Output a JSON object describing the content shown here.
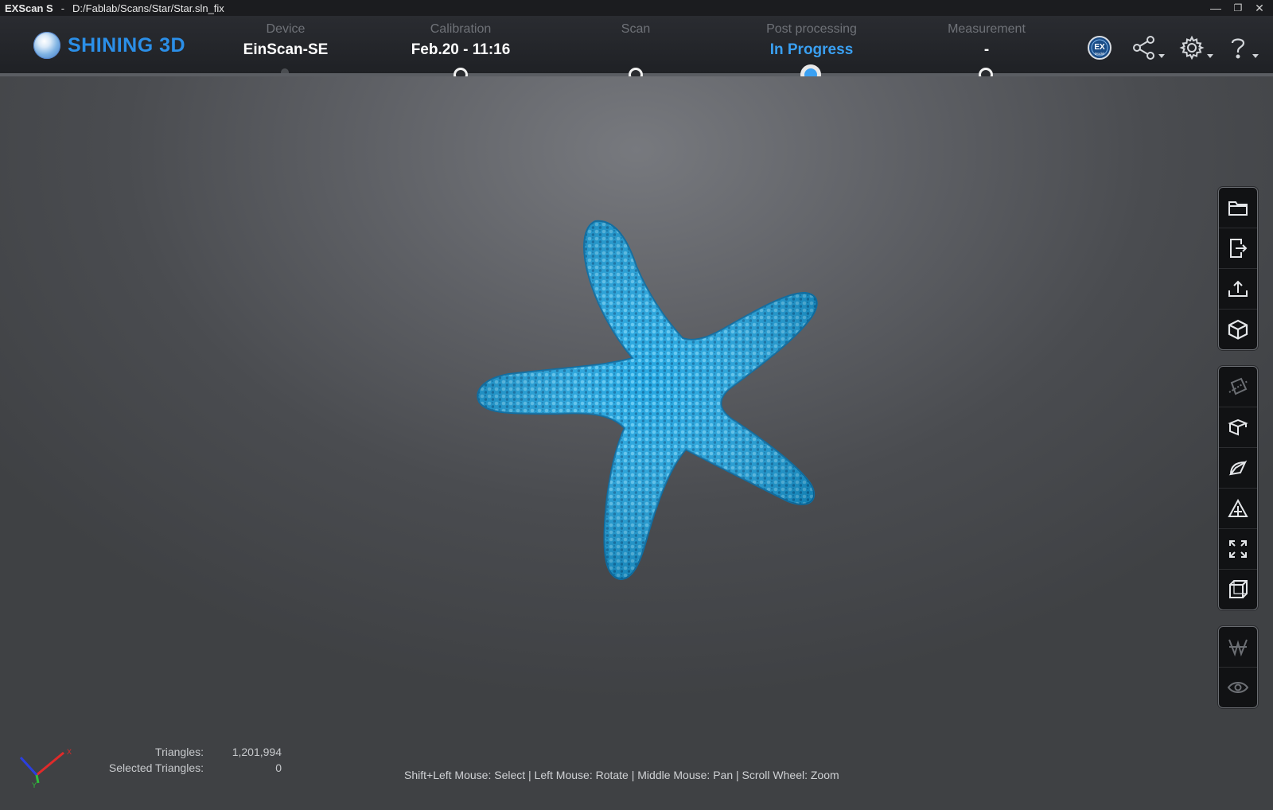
{
  "titlebar": {
    "app_name": "EXScan S",
    "separator": "-",
    "file_path": "D:/Fablab/Scans/Star/Star.sln_fix",
    "minimize_glyph": "—",
    "restore_glyph": "❐",
    "close_glyph": "✕"
  },
  "header": {
    "logo_text": "SHINING 3D",
    "steps": [
      {
        "label": "Device",
        "value": "EinScan-SE",
        "state": "done"
      },
      {
        "label": "Calibration",
        "value": "Feb.20 - 11:16",
        "state": "pending"
      },
      {
        "label": "Scan",
        "value": "",
        "state": "pending"
      },
      {
        "label": "Post processing",
        "value": "In Progress",
        "state": "active"
      },
      {
        "label": "Measurement",
        "value": "-",
        "state": "pending"
      }
    ],
    "icons": [
      "exmodel-icon",
      "share-icon",
      "settings-icon",
      "help-icon"
    ],
    "exmodel_badge": "EX",
    "exmodel_caption": "Model"
  },
  "toolbar": {
    "groups": [
      [
        "open-folder-icon",
        "export-icon",
        "upload-icon",
        "cube-icon"
      ],
      [
        "plane-cut-icon",
        "box-icon",
        "curve-icon",
        "triangle-icon",
        "fit-view-icon",
        "wireframe-box-icon"
      ],
      [
        "mesh-icon",
        "eye-icon"
      ]
    ]
  },
  "stats": {
    "triangles_label": "Triangles:",
    "triangles_value": "1,201,994",
    "selected_label": "Selected Triangles:",
    "selected_value": "0"
  },
  "hint": "Shift+Left Mouse: Select | Left Mouse: Rotate | Middle Mouse: Pan | Scroll Wheel: Zoom",
  "axes": {
    "x": "X",
    "y": "Y"
  },
  "colors": {
    "accent": "#3aa0f2",
    "logo": "#2b8fe8",
    "model": "#1aa3e0"
  }
}
